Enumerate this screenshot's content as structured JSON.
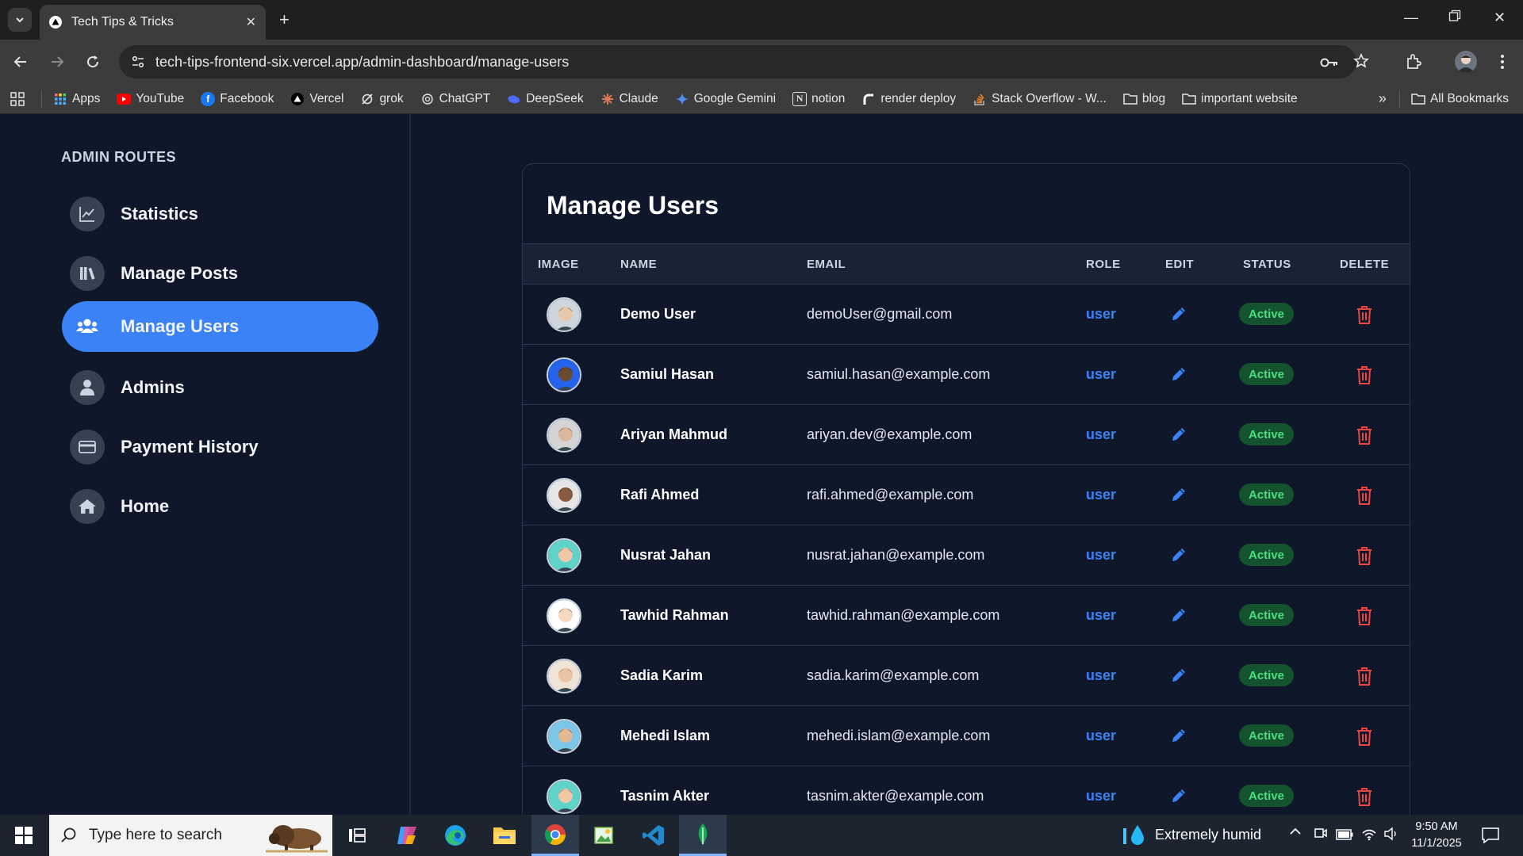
{
  "browser": {
    "tab_title": "Tech Tips & Tricks",
    "url": "tech-tips-frontend-six.vercel.app/admin-dashboard/manage-users",
    "bookmarks": [
      {
        "label": "Apps",
        "icon": "apps-grid-icon"
      },
      {
        "label": "YouTube",
        "icon": "youtube-icon"
      },
      {
        "label": "Facebook",
        "icon": "facebook-icon"
      },
      {
        "label": "Vercel",
        "icon": "vercel-icon"
      },
      {
        "label": "grok",
        "icon": "grok-icon"
      },
      {
        "label": "ChatGPT",
        "icon": "chatgpt-icon"
      },
      {
        "label": "DeepSeek",
        "icon": "deepseek-icon"
      },
      {
        "label": "Claude",
        "icon": "claude-icon"
      },
      {
        "label": "Google Gemini",
        "icon": "gemini-icon"
      },
      {
        "label": "notion",
        "icon": "notion-icon"
      },
      {
        "label": "render deploy",
        "icon": "render-icon"
      },
      {
        "label": "Stack Overflow - W...",
        "icon": "stackoverflow-icon"
      },
      {
        "label": "blog",
        "icon": "folder-icon"
      },
      {
        "label": "important website",
        "icon": "folder-icon"
      }
    ],
    "all_bookmarks": "All Bookmarks"
  },
  "sidebar": {
    "heading": "ADMIN ROUTES",
    "items": [
      {
        "label": "Statistics",
        "icon": "chart-line-icon",
        "active": false
      },
      {
        "label": "Manage Posts",
        "icon": "library-icon",
        "active": false
      },
      {
        "label": "Manage Users",
        "icon": "users-icon",
        "active": true
      },
      {
        "label": "Admins",
        "icon": "user-icon",
        "active": false
      },
      {
        "label": "Payment History",
        "icon": "credit-card-icon",
        "active": false
      },
      {
        "label": "Home",
        "icon": "home-icon",
        "active": false
      }
    ]
  },
  "main": {
    "title": "Manage Users",
    "columns": [
      "IMAGE",
      "NAME",
      "EMAIL",
      "ROLE",
      "EDIT",
      "STATUS",
      "DELETE"
    ],
    "users": [
      {
        "name": "Demo User",
        "email": "demoUser@gmail.com",
        "role": "user",
        "status": "Active"
      },
      {
        "name": "Samiul Hasan",
        "email": "samiul.hasan@example.com",
        "role": "user",
        "status": "Active"
      },
      {
        "name": "Ariyan Mahmud",
        "email": "ariyan.dev@example.com",
        "role": "user",
        "status": "Active"
      },
      {
        "name": "Rafi Ahmed",
        "email": "rafi.ahmed@example.com",
        "role": "user",
        "status": "Active"
      },
      {
        "name": "Nusrat Jahan",
        "email": "nusrat.jahan@example.com",
        "role": "user",
        "status": "Active"
      },
      {
        "name": "Tawhid Rahman",
        "email": "tawhid.rahman@example.com",
        "role": "user",
        "status": "Active"
      },
      {
        "name": "Sadia Karim",
        "email": "sadia.karim@example.com",
        "role": "user",
        "status": "Active"
      },
      {
        "name": "Mehedi Islam",
        "email": "mehedi.islam@example.com",
        "role": "user",
        "status": "Active"
      },
      {
        "name": "Tasnim Akter",
        "email": "tasnim.akter@example.com",
        "role": "user",
        "status": "Active"
      }
    ]
  },
  "taskbar": {
    "search_placeholder": "Type here to search",
    "weather": "Extremely humid",
    "time": "9:50 AM",
    "date": "11/1/2025"
  },
  "colors": {
    "accent": "#3b82f6",
    "page_bg": "#0f172a",
    "status_bg": "#14532d",
    "status_text": "#4ade80",
    "delete": "#ef4444"
  }
}
